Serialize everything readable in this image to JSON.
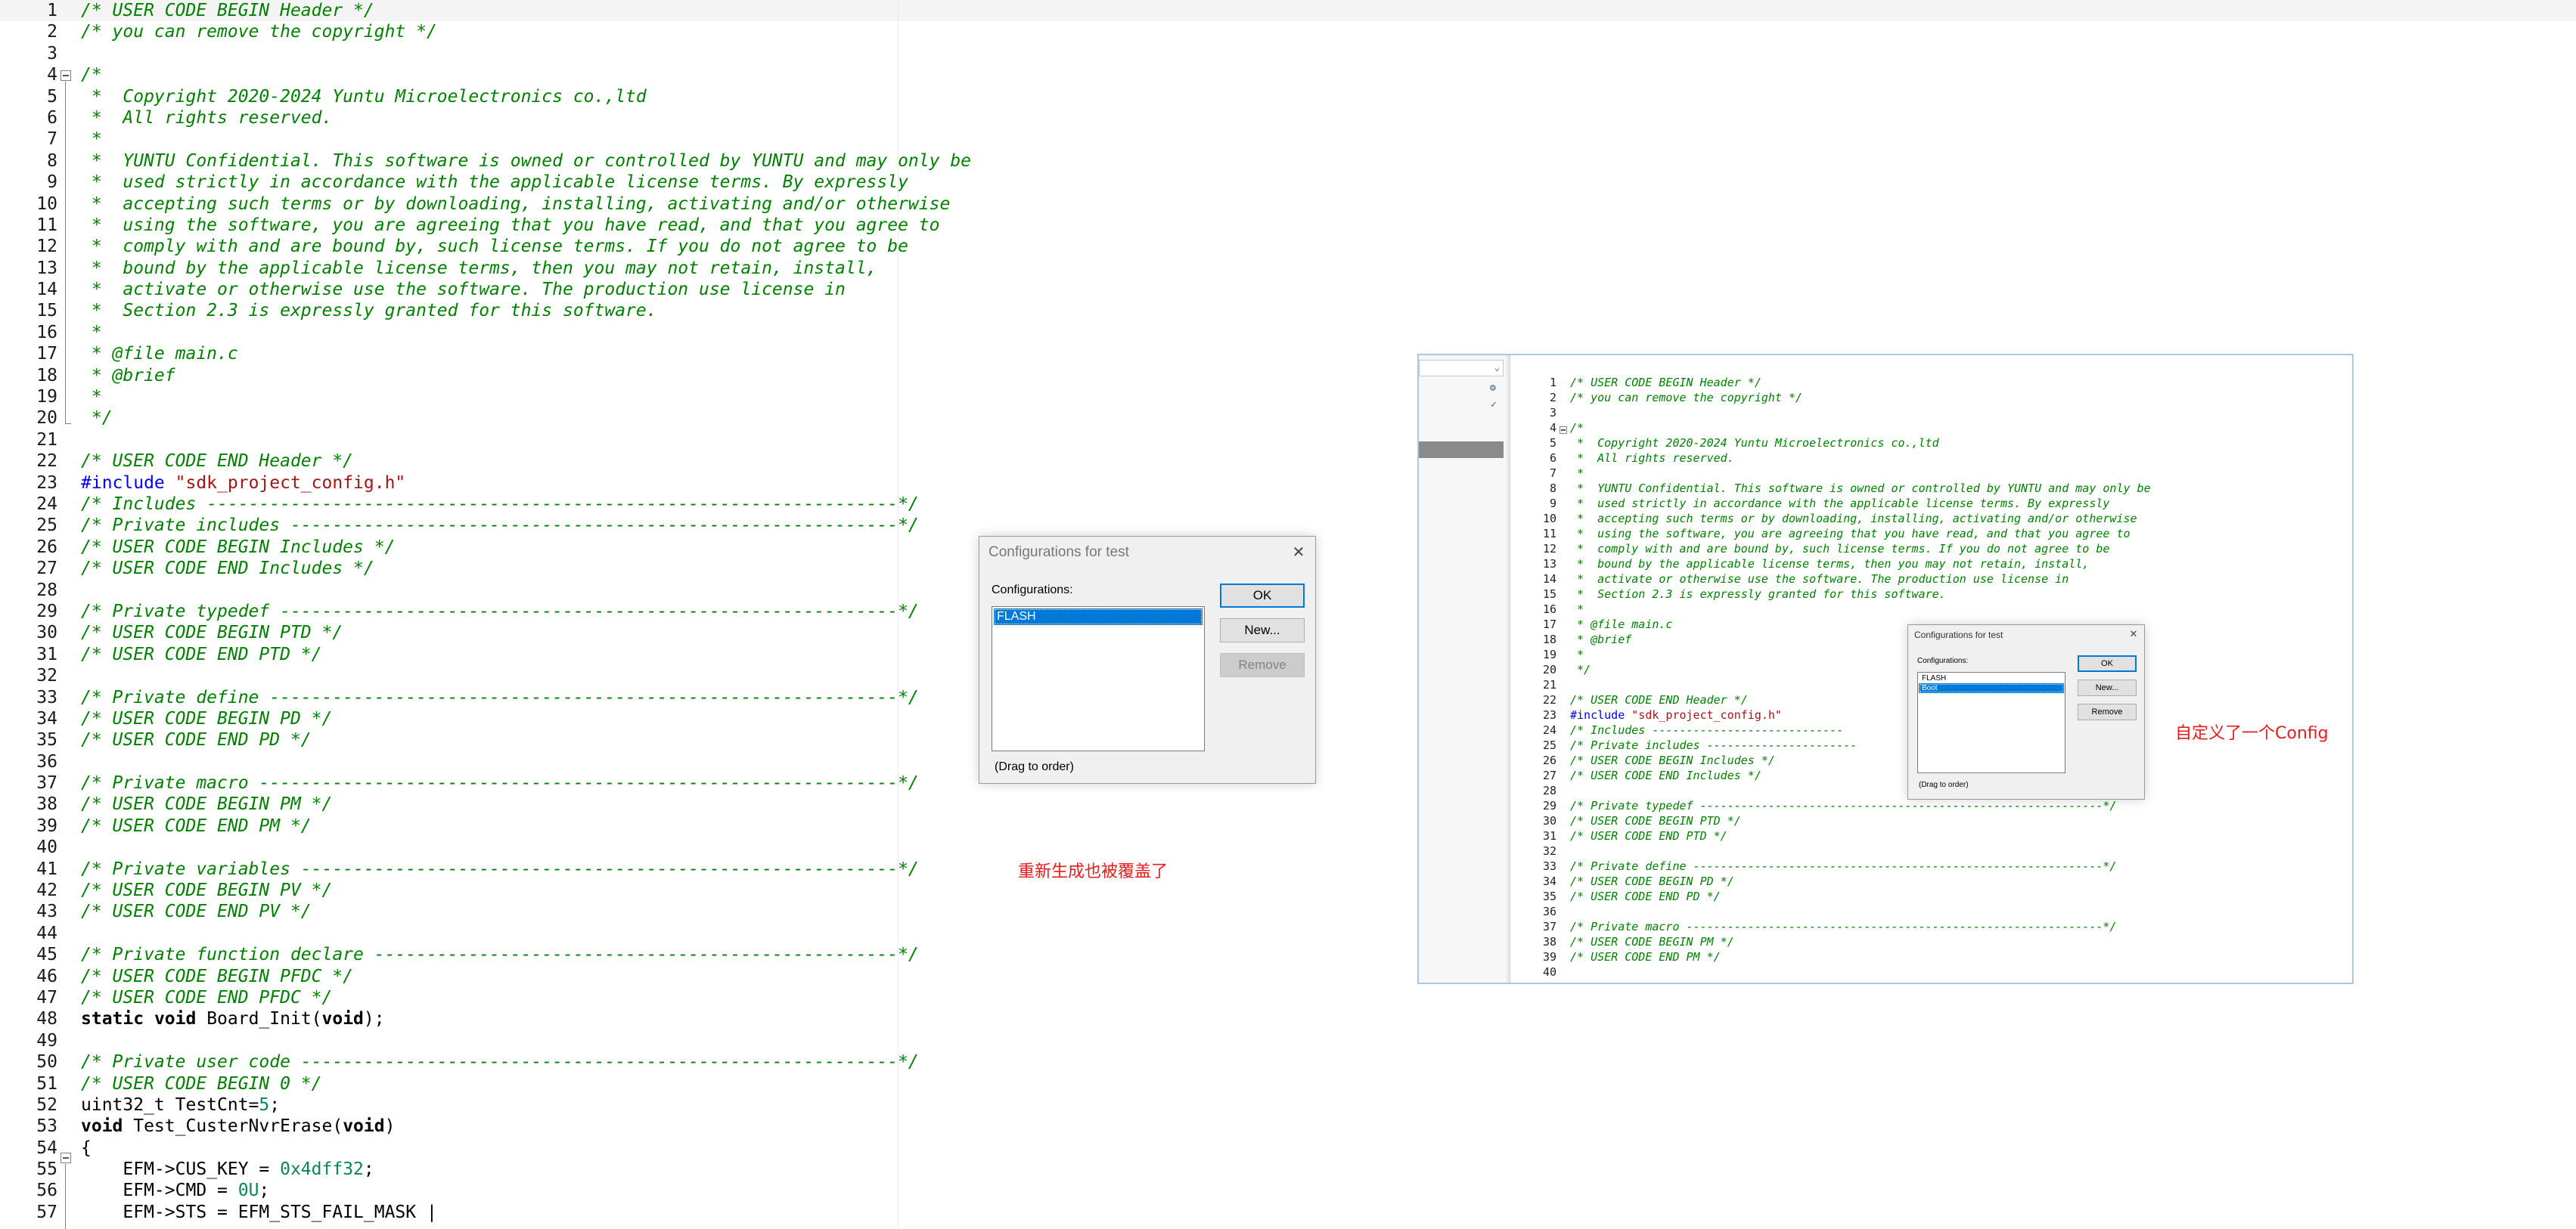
{
  "editor": {
    "lines": [
      {
        "n": "1",
        "type": "c",
        "text": "/* USER CODE BEGIN Header */"
      },
      {
        "n": "2",
        "type": "c",
        "text": "/* you can remove the copyright */"
      },
      {
        "n": "3",
        "type": "c",
        "text": ""
      },
      {
        "n": "4",
        "type": "c",
        "text": "/*"
      },
      {
        "n": "5",
        "type": "c",
        "text": " *  Copyright 2020-2024 Yuntu Microelectronics co.,ltd"
      },
      {
        "n": "6",
        "type": "c",
        "text": " *  All rights reserved."
      },
      {
        "n": "7",
        "type": "c",
        "text": " *"
      },
      {
        "n": "8",
        "type": "c",
        "text": " *  YUNTU Confidential. This software is owned or controlled by YUNTU and may only be"
      },
      {
        "n": "9",
        "type": "c",
        "text": " *  used strictly in accordance with the applicable license terms. By expressly"
      },
      {
        "n": "10",
        "type": "c",
        "text": " *  accepting such terms or by downloading, installing, activating and/or otherwise"
      },
      {
        "n": "11",
        "type": "c",
        "text": " *  using the software, you are agreeing that you have read, and that you agree to"
      },
      {
        "n": "12",
        "type": "c",
        "text": " *  comply with and are bound by, such license terms. If you do not agree to be"
      },
      {
        "n": "13",
        "type": "c",
        "text": " *  bound by the applicable license terms, then you may not retain, install,"
      },
      {
        "n": "14",
        "type": "c",
        "text": " *  activate or otherwise use the software. The production use license in"
      },
      {
        "n": "15",
        "type": "c",
        "text": " *  Section 2.3 is expressly granted for this software."
      },
      {
        "n": "16",
        "type": "c",
        "text": " *"
      },
      {
        "n": "17",
        "type": "c",
        "text": " * @file main.c"
      },
      {
        "n": "18",
        "type": "c",
        "text": " * @brief"
      },
      {
        "n": "19",
        "type": "c",
        "text": " *"
      },
      {
        "n": "20",
        "type": "c",
        "text": " */"
      },
      {
        "n": "21",
        "type": "c",
        "text": ""
      },
      {
        "n": "22",
        "type": "c",
        "text": "/* USER CODE END Header */"
      },
      {
        "n": "23",
        "type": "inc",
        "kw": "#include",
        "str": "\"sdk_project_config.h\""
      },
      {
        "n": "24",
        "type": "c",
        "text": "/* Includes ------------------------------------------------------------------*/"
      },
      {
        "n": "25",
        "type": "c",
        "text": "/* Private includes ----------------------------------------------------------*/"
      },
      {
        "n": "26",
        "type": "c",
        "text": "/* USER CODE BEGIN Includes */"
      },
      {
        "n": "27",
        "type": "c",
        "text": "/* USER CODE END Includes */"
      },
      {
        "n": "28",
        "type": "c",
        "text": ""
      },
      {
        "n": "29",
        "type": "c",
        "text": "/* Private typedef -----------------------------------------------------------*/"
      },
      {
        "n": "30",
        "type": "c",
        "text": "/* USER CODE BEGIN PTD */"
      },
      {
        "n": "31",
        "type": "c",
        "text": "/* USER CODE END PTD */"
      },
      {
        "n": "32",
        "type": "c",
        "text": ""
      },
      {
        "n": "33",
        "type": "c",
        "text": "/* Private define ------------------------------------------------------------*/"
      },
      {
        "n": "34",
        "type": "c",
        "text": "/* USER CODE BEGIN PD */"
      },
      {
        "n": "35",
        "type": "c",
        "text": "/* USER CODE END PD */"
      },
      {
        "n": "36",
        "type": "c",
        "text": ""
      },
      {
        "n": "37",
        "type": "c",
        "text": "/* Private macro -------------------------------------------------------------*/"
      },
      {
        "n": "38",
        "type": "c",
        "text": "/* USER CODE BEGIN PM */"
      },
      {
        "n": "39",
        "type": "c",
        "text": "/* USER CODE END PM */"
      },
      {
        "n": "40",
        "type": "c",
        "text": ""
      },
      {
        "n": "41",
        "type": "c",
        "text": "/* Private variables ---------------------------------------------------------*/"
      },
      {
        "n": "42",
        "type": "c",
        "text": "/* USER CODE BEGIN PV */"
      },
      {
        "n": "43",
        "type": "c",
        "text": "/* USER CODE END PV */"
      },
      {
        "n": "44",
        "type": "c",
        "text": ""
      },
      {
        "n": "45",
        "type": "c",
        "text": "/* Private function declare --------------------------------------------------*/"
      },
      {
        "n": "46",
        "type": "c",
        "text": "/* USER CODE BEGIN PFDC */"
      },
      {
        "n": "47",
        "type": "c",
        "text": "/* USER CODE END PFDC */"
      },
      {
        "n": "48",
        "type": "proto",
        "a": "static",
        "b": "void",
        "c": " Board_Init(",
        "d": "void",
        "e": ");"
      },
      {
        "n": "49",
        "type": "c",
        "text": ""
      },
      {
        "n": "50",
        "type": "c",
        "text": "/* Private user code ---------------------------------------------------------*/"
      },
      {
        "n": "51",
        "type": "c",
        "text": "/* USER CODE BEGIN 0 */"
      },
      {
        "n": "52",
        "type": "decl",
        "a": "uint32_t TestCnt=",
        "num": "5",
        "b": ";"
      },
      {
        "n": "53",
        "type": "fn",
        "kw": "void",
        "a": " Test_CusterNvrErase(",
        "kw2": "void",
        "b": ")"
      },
      {
        "n": "54",
        "type": "p",
        "text": "{"
      },
      {
        "n": "55",
        "type": "asg",
        "a": "    EFM->CUS_KEY = ",
        "num": "0x4dff32",
        "b": ";"
      },
      {
        "n": "56",
        "type": "asg",
        "a": "    EFM->CMD = ",
        "num": "0U",
        "b": ";"
      },
      {
        "n": "57",
        "type": "p",
        "text": "    EFM->STS = EFM_STS_FAIL_MASK |"
      }
    ]
  },
  "dialog_main": {
    "title": "Configurations for test",
    "close_glyph": "✕",
    "configurations_label": "Configurations:",
    "items": [
      "FLASH"
    ],
    "selected": 0,
    "ok": "OK",
    "new": "New...",
    "remove": "Remove",
    "hint": "(Drag to order)"
  },
  "annotation_left": "重新生成也被覆盖了",
  "annotation_right": "自定义了一个Config",
  "screenshot": {
    "gear_icon": "⚙",
    "check_icon": "✓",
    "lines": [
      {
        "n": "1",
        "c": true,
        "t": "/* USER CODE BEGIN Header */"
      },
      {
        "n": "2",
        "c": true,
        "t": "/* you can remove the copyright */"
      },
      {
        "n": "3",
        "c": true,
        "t": ""
      },
      {
        "n": "4",
        "c": true,
        "t": "/*"
      },
      {
        "n": "5",
        "c": true,
        "t": " *  Copyright 2020-2024 Yuntu Microelectronics co.,ltd"
      },
      {
        "n": "6",
        "c": true,
        "t": " *  All rights reserved."
      },
      {
        "n": "7",
        "c": true,
        "t": " *"
      },
      {
        "n": "8",
        "c": true,
        "t": " *  YUNTU Confidential. This software is owned or controlled by YUNTU and may only be"
      },
      {
        "n": "9",
        "c": true,
        "t": " *  used strictly in accordance with the applicable license terms. By expressly"
      },
      {
        "n": "10",
        "c": true,
        "t": " *  accepting such terms or by downloading, installing, activating and/or otherwise"
      },
      {
        "n": "11",
        "c": true,
        "t": " *  using the software, you are agreeing that you have read, and that you agree to"
      },
      {
        "n": "12",
        "c": true,
        "t": " *  comply with and are bound by, such license terms. If you do not agree to be"
      },
      {
        "n": "13",
        "c": true,
        "t": " *  bound by the applicable license terms, then you may not retain, install,"
      },
      {
        "n": "14",
        "c": true,
        "t": " *  activate or otherwise use the software. The production use license in"
      },
      {
        "n": "15",
        "c": true,
        "t": " *  Section 2.3 is expressly granted for this software."
      },
      {
        "n": "16",
        "c": true,
        "t": " *"
      },
      {
        "n": "17",
        "c": true,
        "t": " * @file main.c"
      },
      {
        "n": "18",
        "c": true,
        "t": " * @brief"
      },
      {
        "n": "19",
        "c": true,
        "t": " *"
      },
      {
        "n": "20",
        "c": true,
        "t": " */"
      },
      {
        "n": "21",
        "c": true,
        "t": ""
      },
      {
        "n": "22",
        "c": true,
        "t": "/* USER CODE END Header */"
      },
      {
        "n": "23",
        "inc": true,
        "kw": "#include",
        "s": "\"sdk_project_config.h\""
      },
      {
        "n": "24",
        "c": true,
        "t": "/* Includes ----------------------------"
      },
      {
        "n": "25",
        "c": true,
        "t": "/* Private includes ----------------------"
      },
      {
        "n": "26",
        "c": true,
        "t": "/* USER CODE BEGIN Includes */"
      },
      {
        "n": "27",
        "c": true,
        "t": "/* USER CODE END Includes */"
      },
      {
        "n": "28",
        "c": true,
        "t": ""
      },
      {
        "n": "29",
        "c": true,
        "t": "/* Private typedef -----------------------------------------------------------*/"
      },
      {
        "n": "30",
        "c": true,
        "t": "/* USER CODE BEGIN PTD */"
      },
      {
        "n": "31",
        "c": true,
        "t": "/* USER CODE END PTD */"
      },
      {
        "n": "32",
        "c": true,
        "t": ""
      },
      {
        "n": "33",
        "c": true,
        "t": "/* Private define ------------------------------------------------------------*/"
      },
      {
        "n": "34",
        "c": true,
        "t": "/* USER CODE BEGIN PD */"
      },
      {
        "n": "35",
        "c": true,
        "t": "/* USER CODE END PD */"
      },
      {
        "n": "36",
        "c": true,
        "t": ""
      },
      {
        "n": "37",
        "c": true,
        "t": "/* Private macro -------------------------------------------------------------*/"
      },
      {
        "n": "38",
        "c": true,
        "t": "/* USER CODE BEGIN PM */"
      },
      {
        "n": "39",
        "c": true,
        "t": "/* USER CODE END PM */"
      },
      {
        "n": "40",
        "c": true,
        "t": ""
      }
    ],
    "dialog": {
      "title": "Configurations for test",
      "close_glyph": "✕",
      "configurations_label": "Configurations:",
      "items": [
        "FLASH",
        "Boot"
      ],
      "selected": 1,
      "ok": "OK",
      "new": "New...",
      "remove": "Remove",
      "hint": "(Drag to order)"
    }
  }
}
